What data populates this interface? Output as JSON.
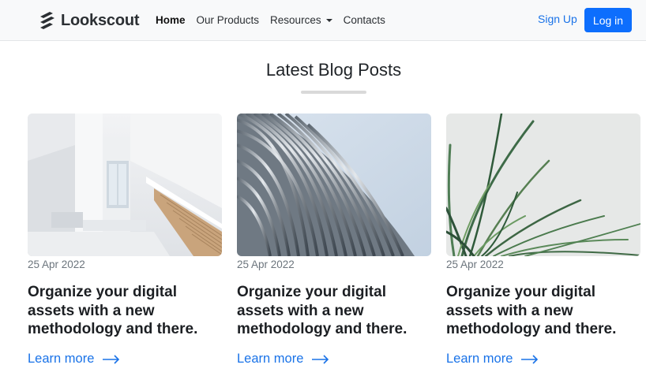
{
  "brand": {
    "name": "Lookscout"
  },
  "nav": {
    "items": [
      {
        "label": "Home"
      },
      {
        "label": "Our Products"
      },
      {
        "label": "Resources"
      },
      {
        "label": "Contacts"
      }
    ],
    "signup_label": "Sign Up",
    "login_label": "Log in"
  },
  "section": {
    "title": "Latest Blog Posts"
  },
  "posts": [
    {
      "date": "25 Apr 2022",
      "title": "Organize your digital assets with a new methodology and there.",
      "link_label": "Learn more",
      "image": "white-staircase-interior"
    },
    {
      "date": "25 Apr 2022",
      "title": "Organize your digital assets with a new methodology and there.",
      "link_label": "Learn more",
      "image": "curved-metal-facade"
    },
    {
      "date": "25 Apr 2022",
      "title": "Organize your digital assets with a new methodology and there.",
      "link_label": "Learn more",
      "image": "green-plant-leaves"
    }
  ],
  "colors": {
    "accent": "#0d6efd",
    "link": "#1a73e8",
    "navbar_bg": "#f8f9fa",
    "muted": "#6c757d"
  }
}
